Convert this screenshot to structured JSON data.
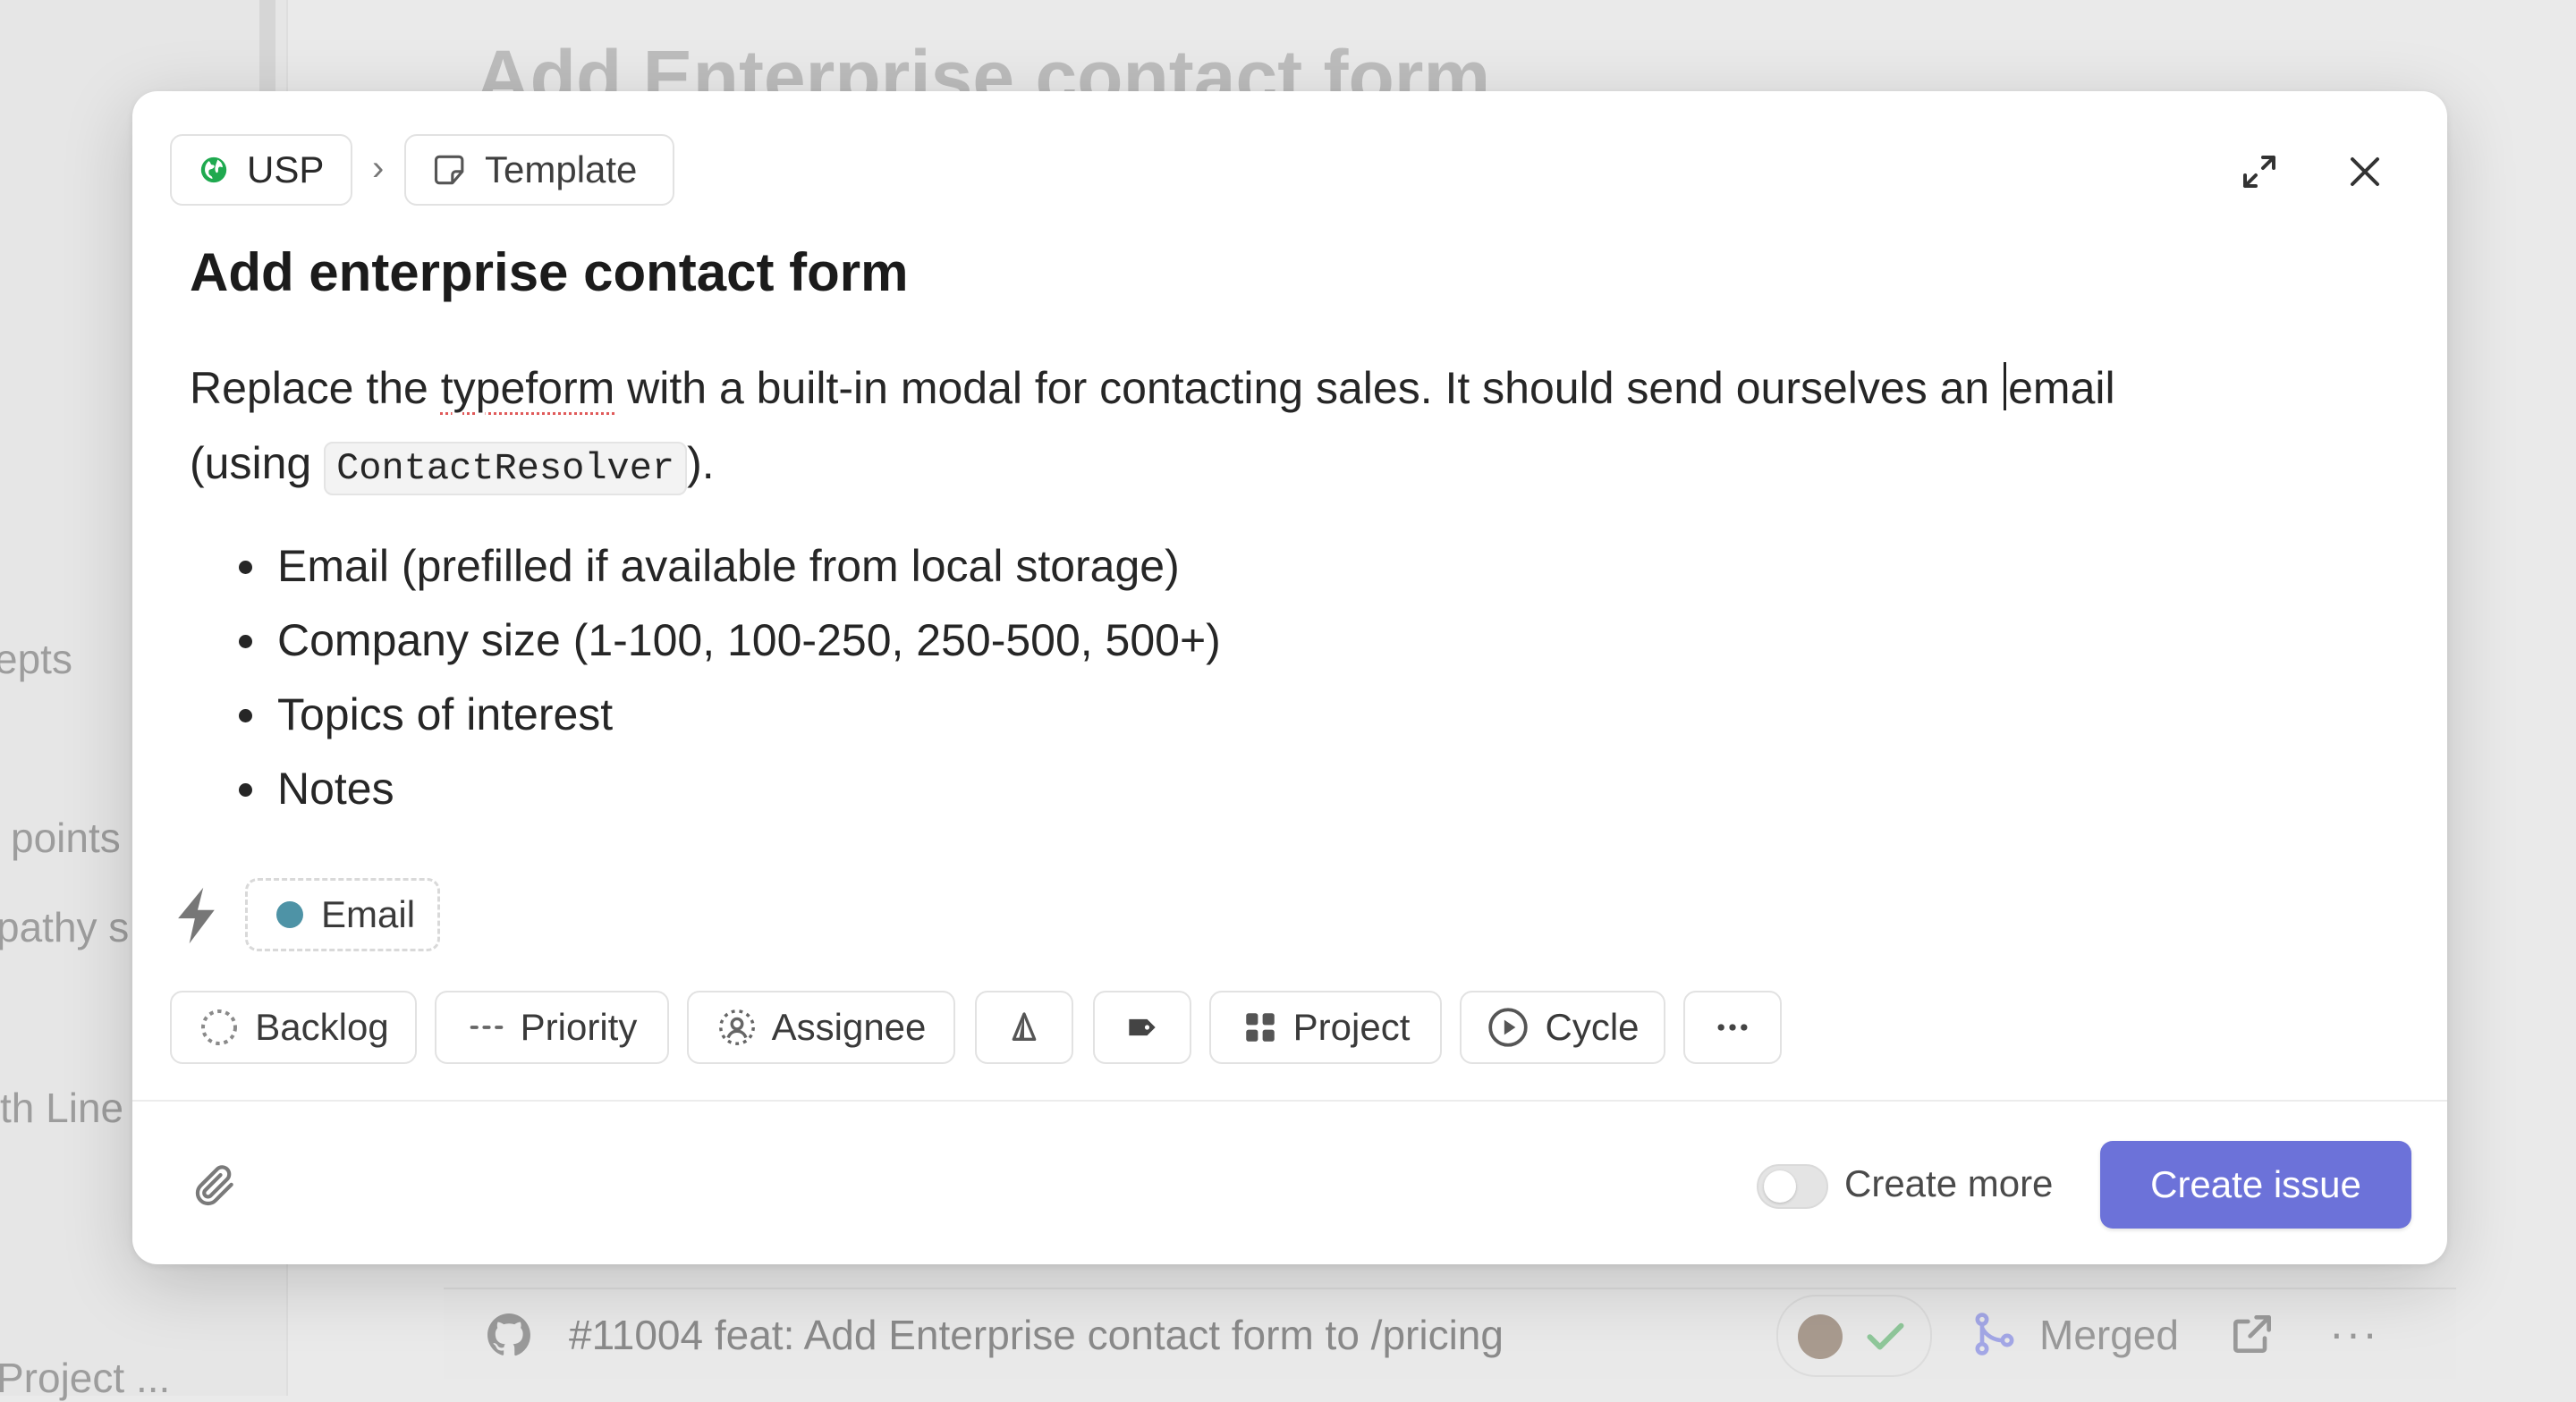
{
  "background": {
    "page_title": "Add Enterprise contact form",
    "sidebar_fragments": [
      "epts",
      "points",
      "pathy s",
      "th Line",
      "Project ..."
    ],
    "pr": {
      "title": "#11004 feat: Add Enterprise contact form to /pricing",
      "status": "Merged"
    }
  },
  "modal": {
    "breadcrumb": {
      "team": "USP",
      "separator": "›",
      "template": "Template"
    },
    "title": "Add enterprise contact form",
    "description": {
      "p1_before_typo": "Replace the ",
      "typo_word": "typeform",
      "p1_after_typo": " with a built-in modal for contacting sales. It should send ourselves an ",
      "p1_after_caret": "email",
      "p2_before_code": "(using ",
      "code": "ContactResolver",
      "p2_after_code": ").",
      "bullets": [
        "Email (prefilled if available from local storage)",
        "Company size (1-100, 100-250, 250-500, 500+)",
        "Topics of interest",
        "Notes"
      ]
    },
    "suggested_label": {
      "name": "Email",
      "color": "#4e93a6"
    },
    "properties": {
      "status": "Backlog",
      "priority": "Priority",
      "assignee": "Assignee",
      "project": "Project",
      "cycle": "Cycle"
    },
    "footer": {
      "create_more_label": "Create more",
      "create_more_on": false,
      "create_button": "Create issue"
    }
  },
  "colors": {
    "accent": "#6c72d9",
    "team_icon": "#1fa94f"
  }
}
